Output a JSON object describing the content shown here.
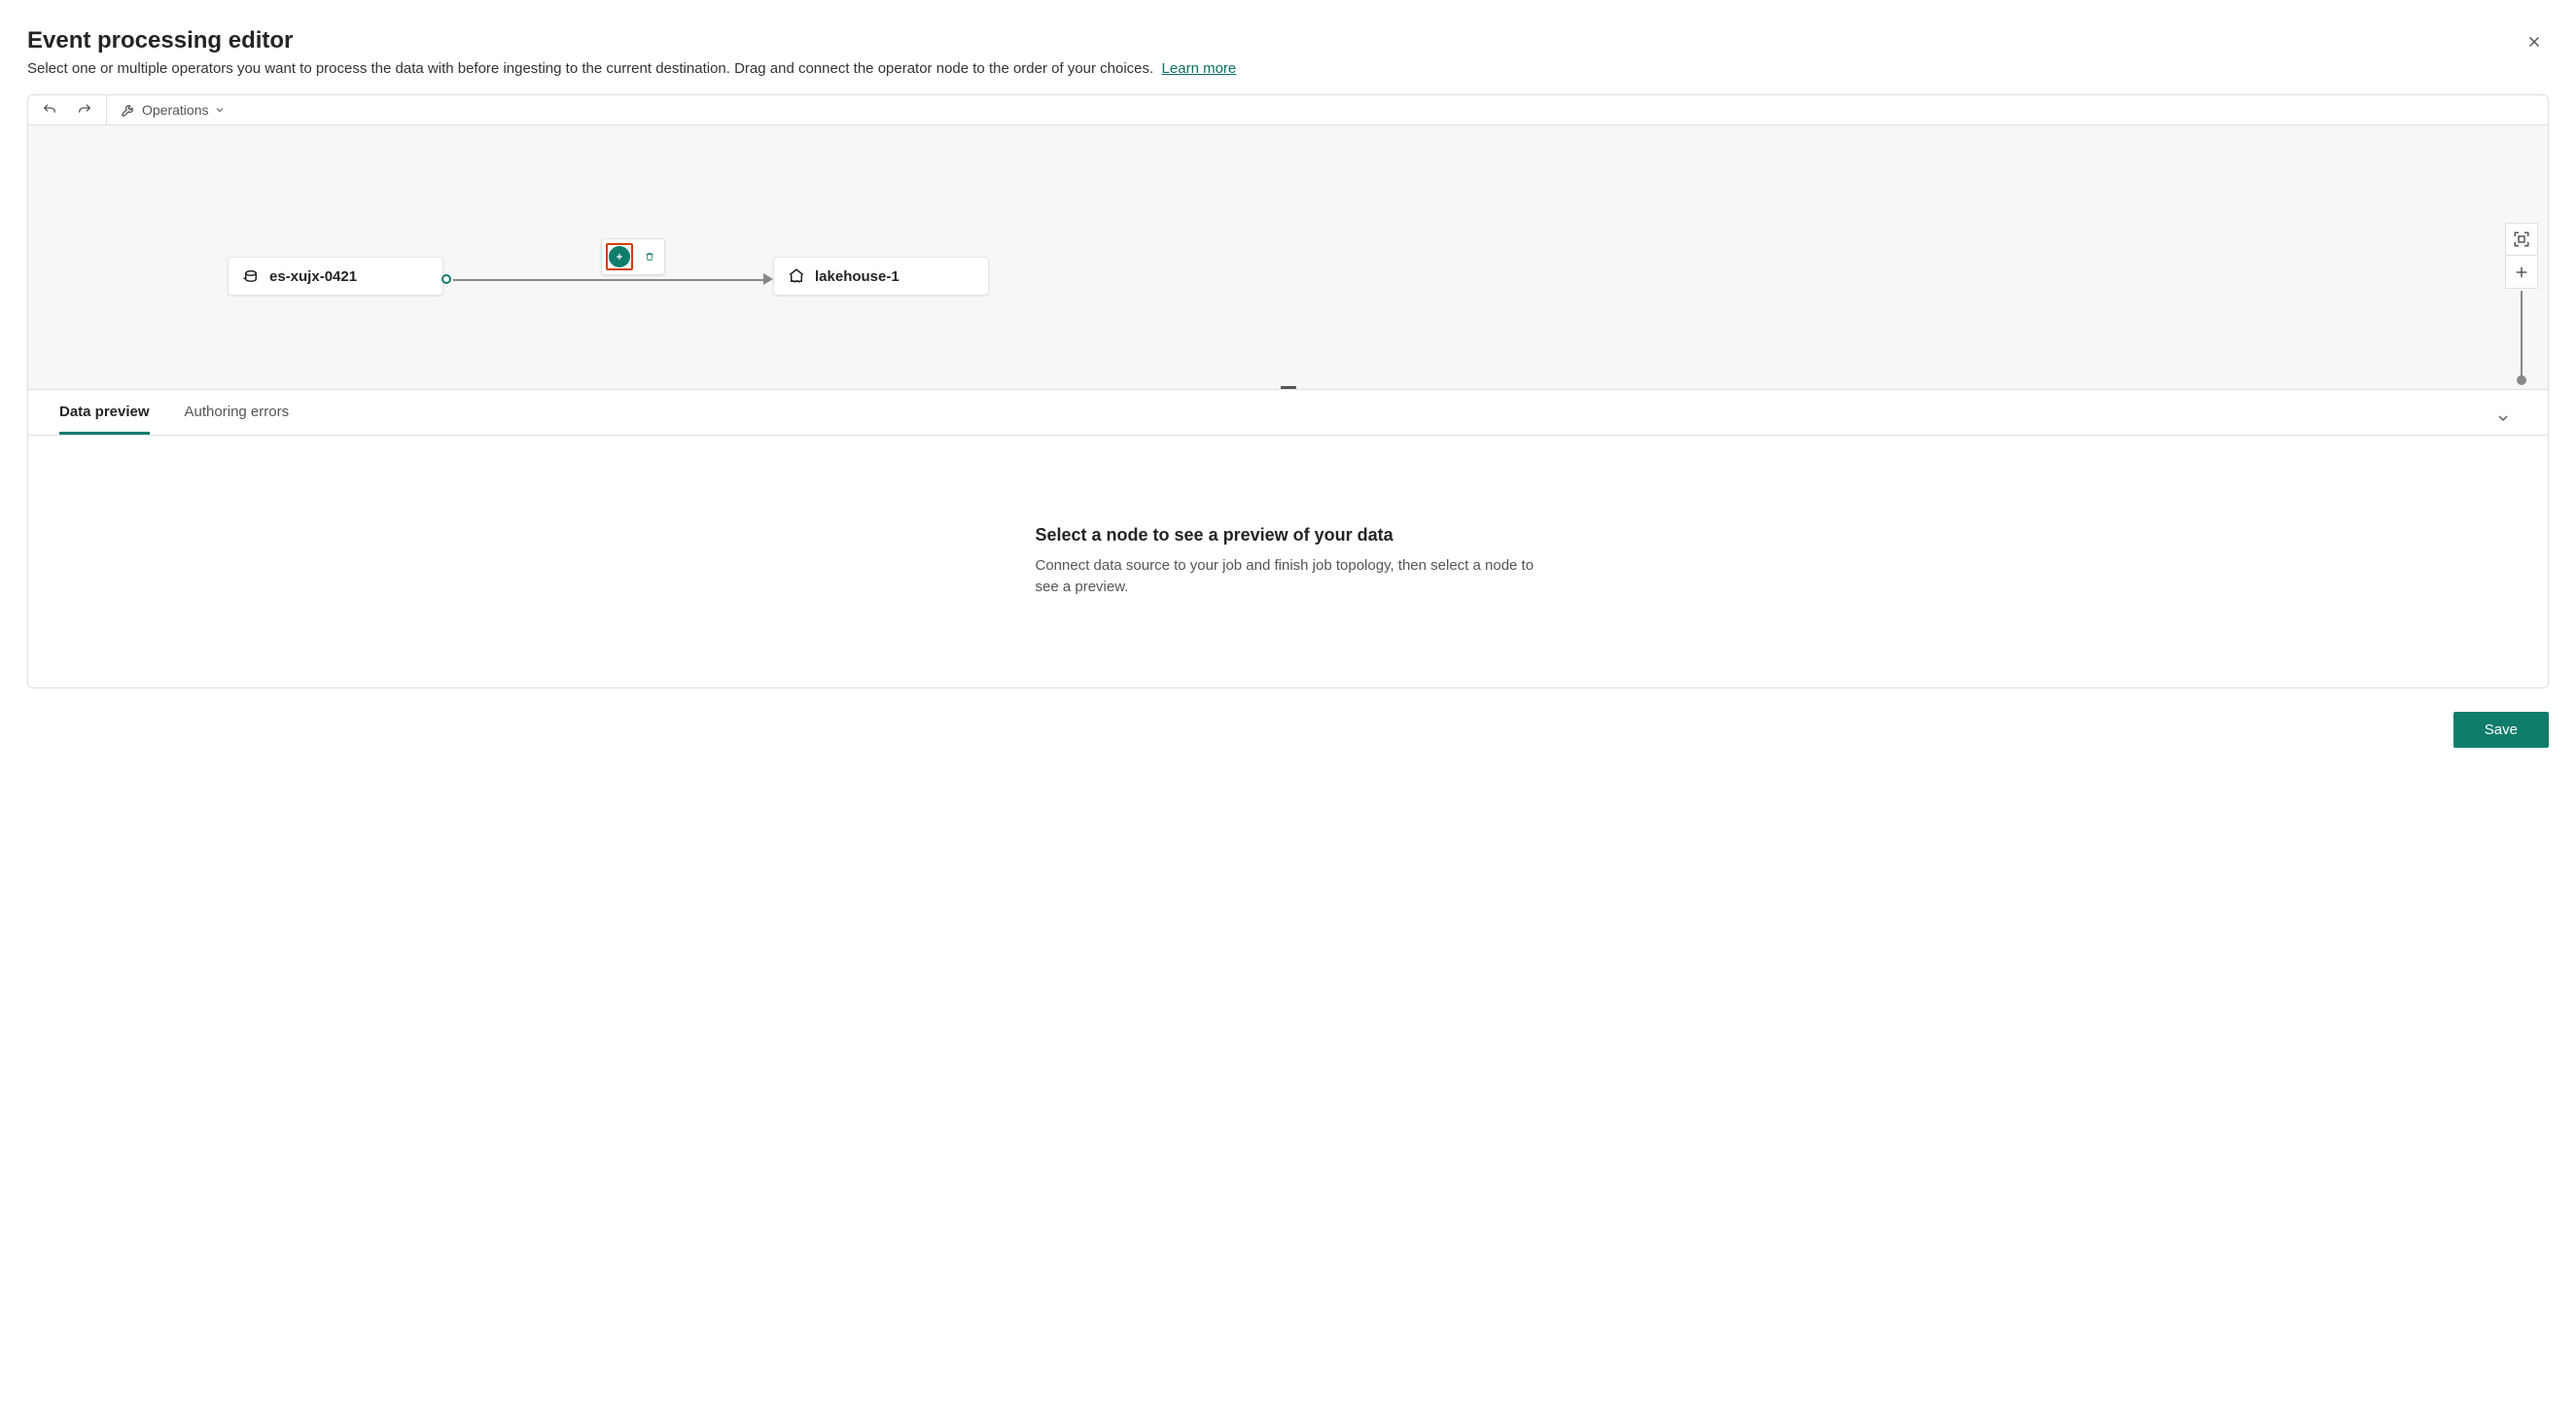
{
  "header": {
    "title": "Event processing editor",
    "subtitle": "Select one or multiple operators you want to process the data with before ingesting to the current destination. Drag and connect the operator node to the order of your choices.",
    "learn_more": "Learn more"
  },
  "toolbar": {
    "operations_label": "Operations"
  },
  "canvas": {
    "source_node": {
      "label": "es-xujx-0421"
    },
    "dest_node": {
      "label": "lakehouse-1"
    }
  },
  "preview": {
    "tabs": {
      "data_preview": "Data preview",
      "authoring_errors": "Authoring errors"
    },
    "empty_title": "Select a node to see a preview of your data",
    "empty_desc": "Connect data source to your job and finish job topology, then select a node to see a preview."
  },
  "footer": {
    "save_label": "Save"
  }
}
